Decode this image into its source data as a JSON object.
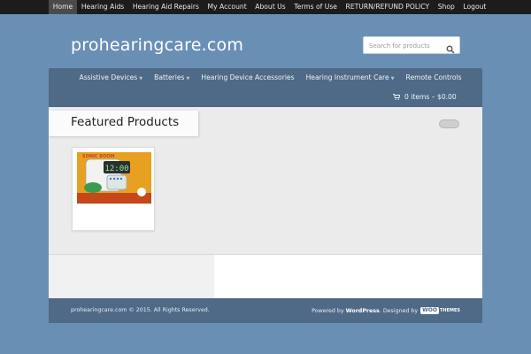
{
  "topnav": {
    "items": [
      {
        "label": "Home",
        "active": true
      },
      {
        "label": "Hearing Aids"
      },
      {
        "label": "Hearing Aid Repairs"
      },
      {
        "label": "My Account"
      },
      {
        "label": "About Us"
      },
      {
        "label": "Terms of Use"
      },
      {
        "label": "RETURN/REFUND POLICY"
      },
      {
        "label": "Shop"
      },
      {
        "label": "Logout"
      }
    ]
  },
  "header": {
    "site_title": "prohearingcare.com",
    "search_placeholder": "Search for products"
  },
  "mainnav": {
    "items": [
      {
        "label": "Assistive Devices",
        "has_sub": true
      },
      {
        "label": "Batteries",
        "has_sub": true
      },
      {
        "label": "Hearing Device Accessories",
        "has_sub": false
      },
      {
        "label": "Hearing Instrument Care",
        "has_sub": true
      },
      {
        "label": "Remote Controls",
        "has_sub": false
      }
    ],
    "cart": "0 items – $0.00"
  },
  "main": {
    "featured_title": "Featured Products",
    "product": {
      "brand_text": "SONIC BOOM",
      "clock_time": "12:00"
    }
  },
  "footer": {
    "copyright": "prohearingcare.com © 2015. All Rights Reserved.",
    "powered_prefix": "Powered by",
    "powered_by": "WordPress",
    "designed_prefix": ". Designed by",
    "designer_logo": "WOO",
    "designer_logo_suffix": "THEMES"
  },
  "colors": {
    "background": "#6a8fb5",
    "nav": "#4e6a87",
    "topbar": "#1c1c1c"
  }
}
